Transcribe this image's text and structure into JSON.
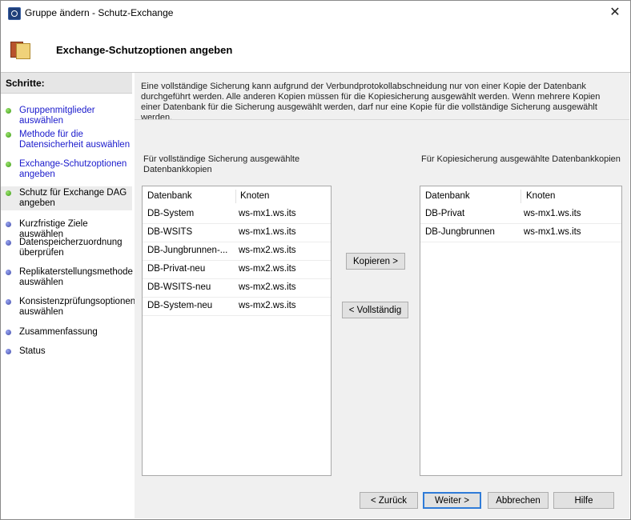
{
  "window": {
    "title": "Gruppe ändern - Schutz-Exchange",
    "close_glyph": "✕"
  },
  "header": {
    "title": "Exchange-Schutzoptionen angeben"
  },
  "sidebar": {
    "heading": "Schritte:",
    "steps": [
      {
        "label": "Gruppenmitglieder auswählen",
        "state": "done-link"
      },
      {
        "label": "Methode für die Datensicherheit auswählen",
        "state": "done-link"
      },
      {
        "label": "Exchange-Schutzoptionen angeben",
        "state": "done-link"
      },
      {
        "label": "Schutz für Exchange DAG angeben",
        "state": "current"
      },
      {
        "label": "Kurzfristige Ziele auswählen",
        "state": "pending"
      },
      {
        "label": "Datenspeicherzuordnung überprüfen",
        "state": "pending"
      },
      {
        "label": "Replikaterstellungsmethode auswählen",
        "state": "pending"
      },
      {
        "label": "Konsistenzprüfungsoptionen auswählen",
        "state": "pending"
      },
      {
        "label": "Zusammenfassung",
        "state": "pending"
      },
      {
        "label": "Status",
        "state": "pending"
      }
    ]
  },
  "main": {
    "description": "Eine vollständige Sicherung kann aufgrund der Verbundprotokollabschneidung nur von einer Kopie der Datenbank durchgeführt werden. Alle anderen Kopien müssen für die Kopiesicherung ausgewählt werden. Wenn mehrere Kopien einer Datenbank für die Sicherung ausgewählt werden, darf nur eine Kopie für die vollständige Sicherung ausgewählt werden.",
    "left_list": {
      "title": "Für vollständige Sicherung ausgewählte Datenbankkopien",
      "col_db": "Datenbank",
      "col_node": "Knoten",
      "rows": [
        {
          "db": "DB-System",
          "node": "ws-mx1.ws.its"
        },
        {
          "db": "DB-WSITS",
          "node": "ws-mx1.ws.its"
        },
        {
          "db": "DB-Jungbrunnen-...",
          "node": "ws-mx2.ws.its"
        },
        {
          "db": "DB-Privat-neu",
          "node": "ws-mx2.ws.its"
        },
        {
          "db": "DB-WSITS-neu",
          "node": "ws-mx2.ws.its"
        },
        {
          "db": "DB-System-neu",
          "node": "ws-mx2.ws.its"
        }
      ]
    },
    "right_list": {
      "title": "Für Kopiesicherung ausgewählte Datenbankkopien",
      "col_db": "Datenbank",
      "col_node": "Knoten",
      "rows": [
        {
          "db": "DB-Privat",
          "node": "ws-mx1.ws.its"
        },
        {
          "db": "DB-Jungbrunnen",
          "node": "ws-mx1.ws.its"
        }
      ]
    },
    "copy_button": "Kopieren >",
    "full_button": "< Vollständig"
  },
  "footer": {
    "back": "< Zurück",
    "next": "Weiter >",
    "cancel": "Abbrechen",
    "help": "Hilfe"
  }
}
